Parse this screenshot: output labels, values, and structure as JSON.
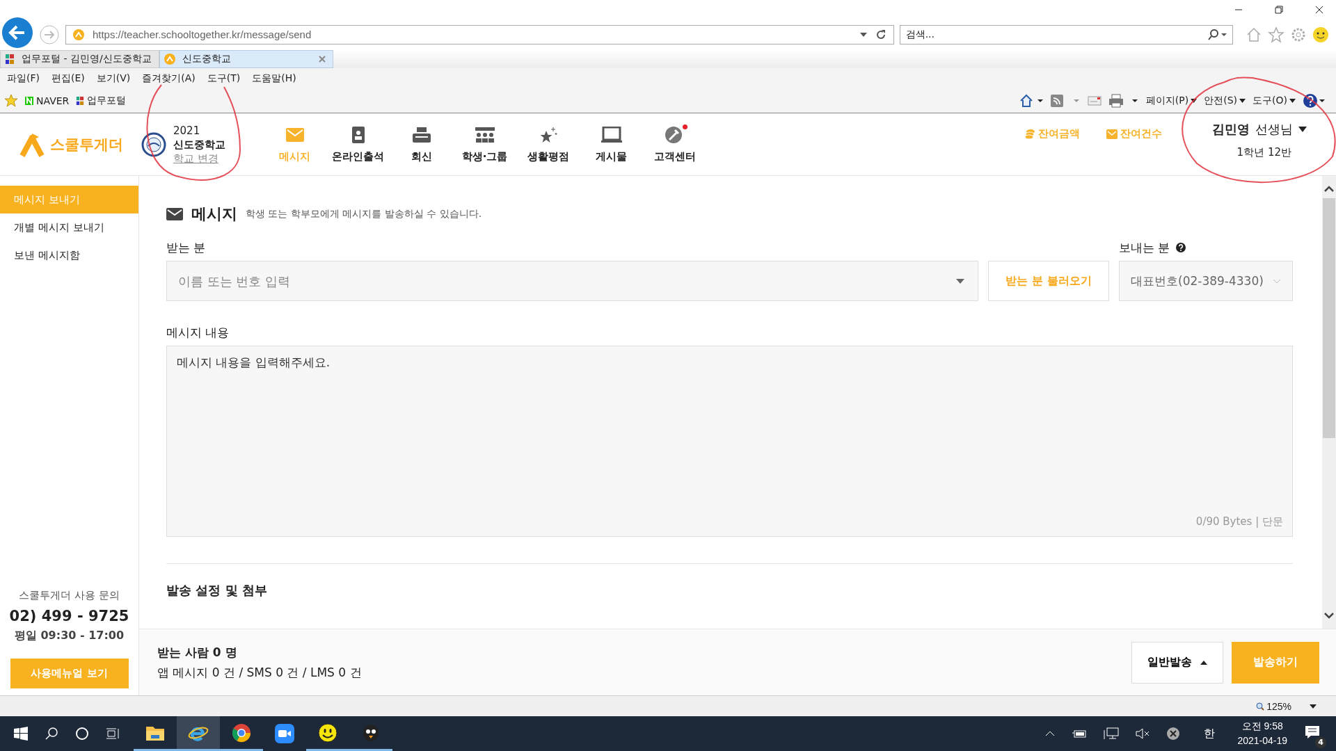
{
  "browser": {
    "address": "https://teacher.schooltogether.kr/message/send",
    "search_placeholder": "검색...",
    "tabs": [
      {
        "label": "업무포털 - 김민영/신도중학교",
        "selected": false
      },
      {
        "label": "신도중학교",
        "selected": true
      }
    ],
    "menu": [
      "파일(F)",
      "편집(E)",
      "보기(V)",
      "즐겨찾기(A)",
      "도구(T)",
      "도움말(H)"
    ],
    "favorites": [
      "NAVER",
      "업무포털"
    ],
    "commands": [
      "페이지(P)",
      "안전(S)",
      "도구(O)"
    ],
    "zoom": "125%"
  },
  "header": {
    "logo": "스쿨투게더",
    "year": "2021",
    "school": "신도중학교",
    "change_school": "학교 변경",
    "nav": [
      {
        "label": "메시지",
        "kind": "mail",
        "selected": true,
        "dot": false
      },
      {
        "label": "온라인출석",
        "kind": "badge",
        "selected": false,
        "dot": false
      },
      {
        "label": "회신",
        "kind": "printer",
        "selected": false,
        "dot": false
      },
      {
        "label": "학생·그룹",
        "kind": "group",
        "selected": false,
        "dot": false
      },
      {
        "label": "생활평점",
        "kind": "star",
        "selected": false,
        "dot": false
      },
      {
        "label": "게시물",
        "kind": "monitor",
        "selected": false,
        "dot": false
      },
      {
        "label": "고객센터",
        "kind": "support",
        "selected": false,
        "dot": true
      }
    ],
    "balance_links": [
      {
        "label": "잔여금액",
        "kind": "coins"
      },
      {
        "label": "잔여건수",
        "kind": "mail"
      }
    ],
    "user": {
      "name": "김민영",
      "title": "선생님",
      "class": "1학년 12반"
    }
  },
  "sidebar": {
    "items": [
      {
        "label": "메시지 보내기",
        "selected": true
      },
      {
        "label": "개별 메시지 보내기",
        "selected": false
      },
      {
        "label": "보낸 메시지함",
        "selected": false
      }
    ],
    "contact_title": "스쿨투게더 사용 문의",
    "phone": "02) 499 - 9725",
    "hours": "평일 09:30 - 17:00",
    "manual_button": "사용메뉴얼 보기"
  },
  "main": {
    "title": "메시지",
    "subtitle": "학생 또는 학부모에게 메시지를 발송하실 수 있습니다.",
    "recipient_label": "받는 분",
    "recipient_placeholder": "이름 또는 번호 입력",
    "load_button": "받는 분 불러오기",
    "sender_label": "보내는 분",
    "sender_value": "대표번호(02-389-4330)",
    "content_label": "메시지 내용",
    "content_placeholder": "메시지 내용을 입력해주세요.",
    "byte_counter": "0/90 Bytes | 단문",
    "settings_heading": "발송 설정 및 첨부"
  },
  "footer": {
    "recipients": "받는 사람 0 명",
    "breakdown": "앱 메시지 0 건 / SMS 0 건 / LMS 0 건",
    "mode_button": "일반발송",
    "send_button": "발송하기"
  },
  "taskbar": {
    "ime": "한",
    "time": "오전 9:58",
    "date": "2021-04-19",
    "notifications": "4"
  }
}
